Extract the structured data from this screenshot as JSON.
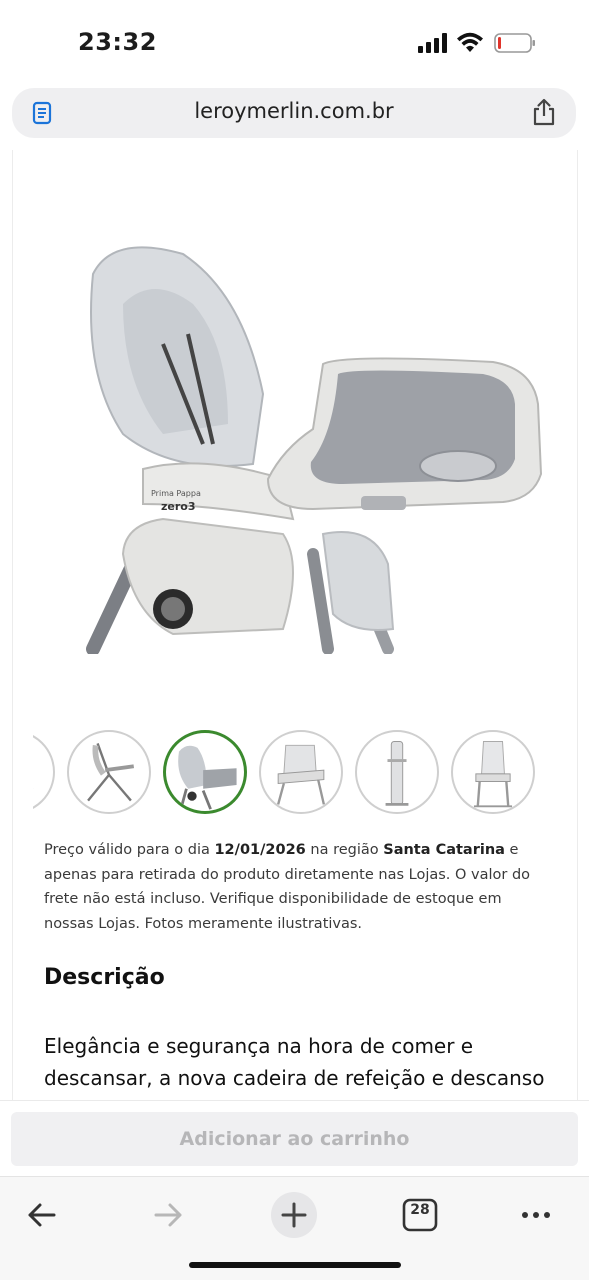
{
  "status_bar": {
    "time": "23:32"
  },
  "address_bar": {
    "url": "leroymerlin.com.br"
  },
  "product": {
    "image_icon": "high-chair-photo",
    "image_brand_line1": "Prima Pappa",
    "image_brand_line2": "zero3",
    "thumbnails": [
      {
        "name": "thumb-partial",
        "selected": false
      },
      {
        "name": "thumb-side-view",
        "selected": false
      },
      {
        "name": "thumb-main-photo",
        "selected": true
      },
      {
        "name": "thumb-front-angle",
        "selected": false
      },
      {
        "name": "thumb-folded",
        "selected": false
      },
      {
        "name": "thumb-front-view",
        "selected": false
      }
    ]
  },
  "price_note": {
    "part1": "Preço válido para o dia ",
    "date": "12/01/2026",
    "part2": " na região ",
    "region": "Santa Catarina",
    "part3": " e apenas para retirada do produto diretamente nas Lojas. O valor do frete não está incluso. Verifique disponibilidade de estoque em nossas Lojas. Fotos meramente ilustrativas."
  },
  "description": {
    "title": "Descrição",
    "text": "Elegância e segurança na hora de comer e descansar, a nova cadeira de refeição e descanso"
  },
  "cart": {
    "button_label": "Adicionar ao carrinho"
  },
  "toolbar": {
    "back_icon": "arrow-left-icon",
    "forward_icon": "arrow-right-icon",
    "new_tab_icon": "plus-icon",
    "tabs_count": "28",
    "more_icon": "ellipsis-icon"
  },
  "colors": {
    "selected_thumb_border": "#3b8a2e",
    "cart_button_bg": "#f0f0f2",
    "cart_button_text": "#b6b6b8"
  }
}
